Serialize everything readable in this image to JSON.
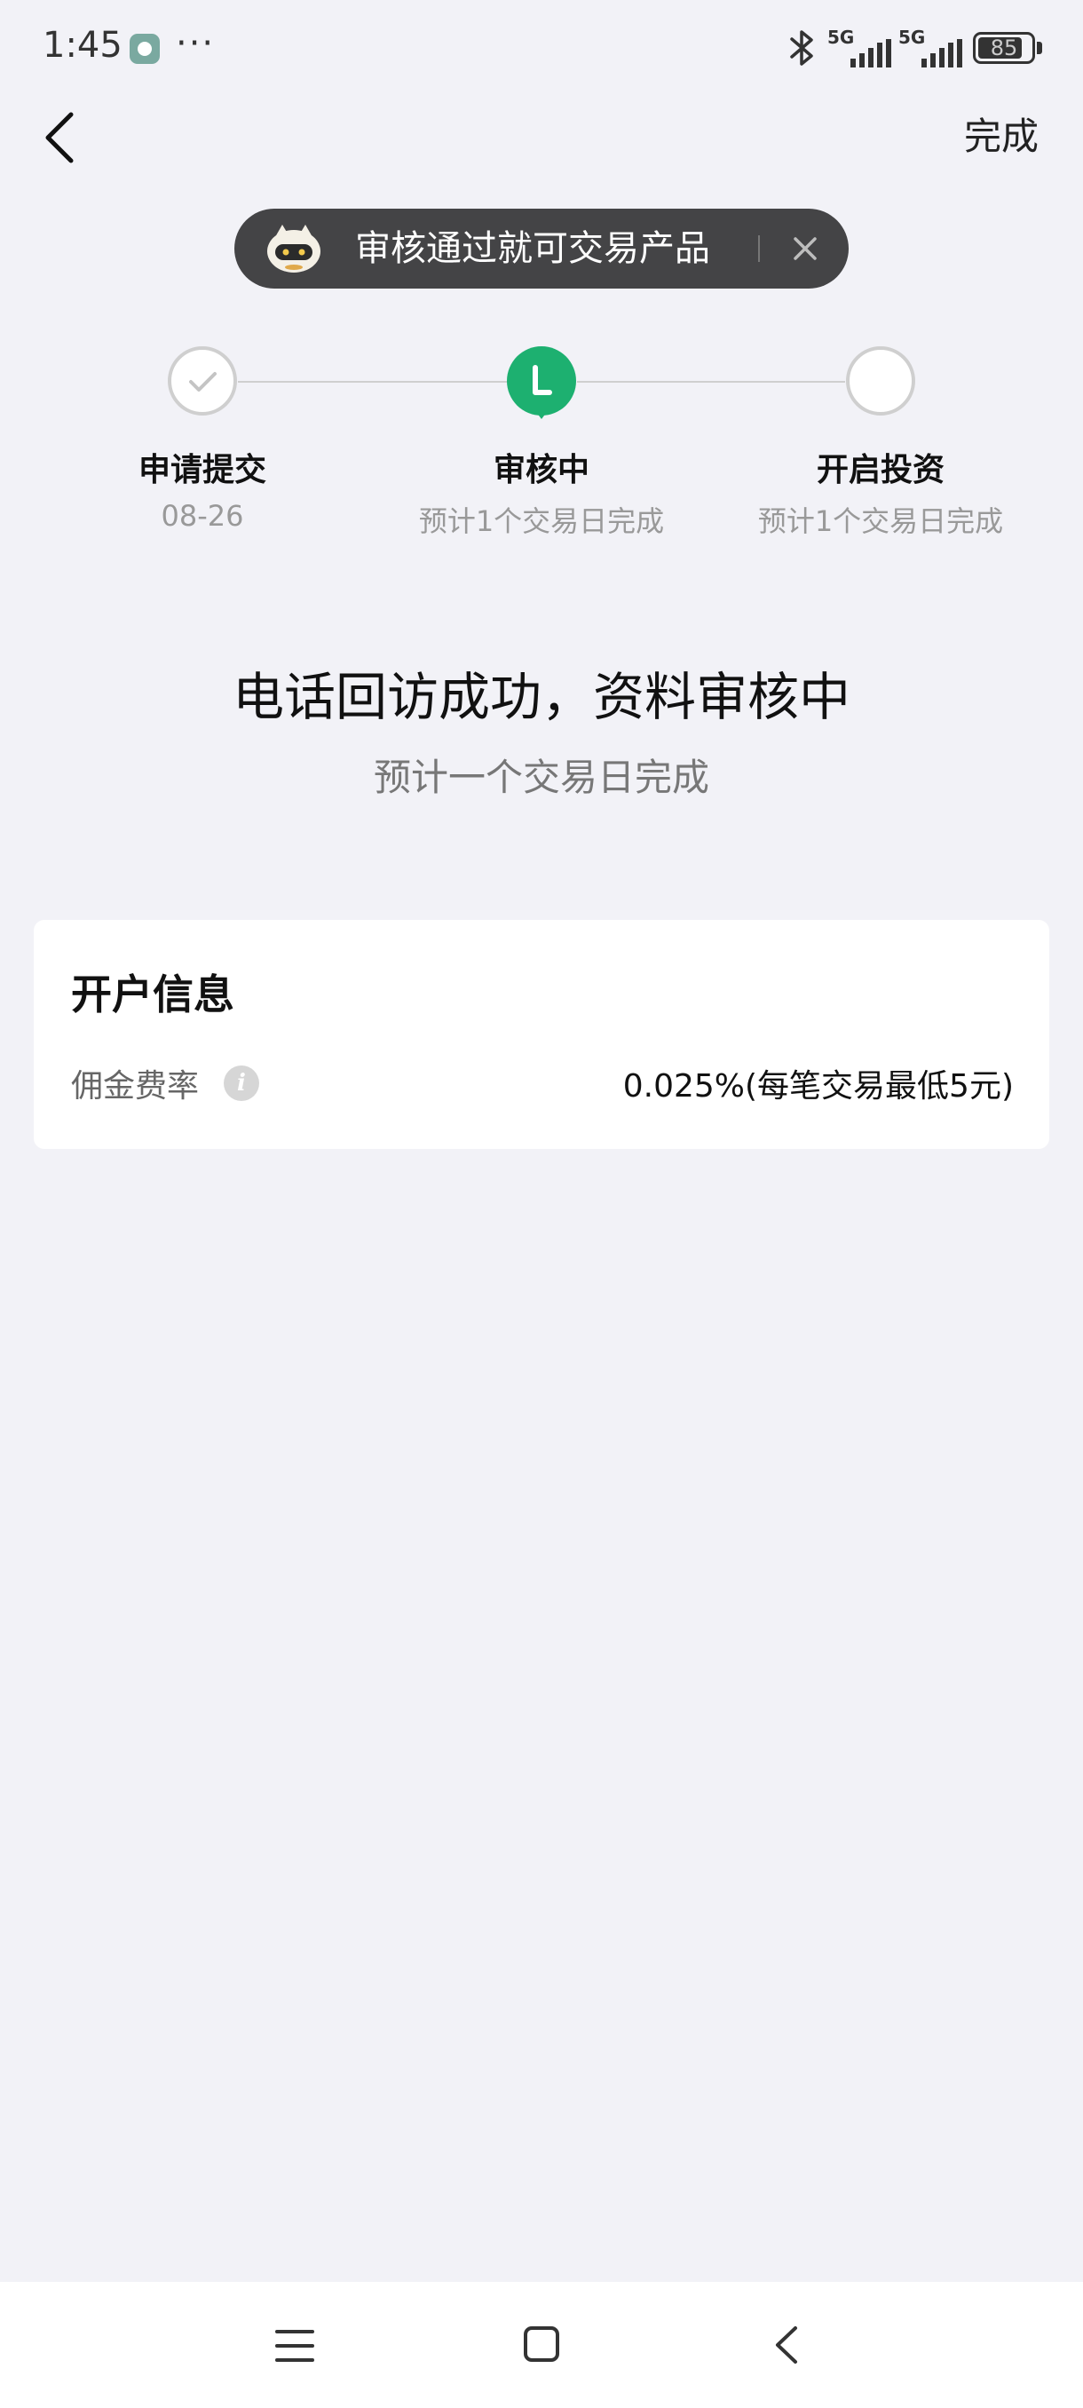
{
  "status_bar": {
    "time": "1:45",
    "dots": "···",
    "network_1": "5G",
    "network_2": "5G",
    "battery": "85",
    "battery_level": 0.85
  },
  "header": {
    "done_label": "完成"
  },
  "toast": {
    "text": "审核通过就可交易产品"
  },
  "steps": [
    {
      "title": "申请提交",
      "subtitle": "08-26",
      "state": "done"
    },
    {
      "title": "审核中",
      "subtitle": "预计1个交易日完成",
      "state": "active"
    },
    {
      "title": "开启投资",
      "subtitle": "预计1个交易日完成",
      "state": "pending"
    }
  ],
  "message": {
    "title": "电话回访成功，资料审核中",
    "subtitle": "预计一个交易日完成"
  },
  "account_info": {
    "title": "开户信息",
    "commission_label": "佣金费率",
    "commission_value": "0.025%(每笔交易最低5元)"
  },
  "colors": {
    "accent": "#1db070",
    "background": "#f2f2f7",
    "toast_bg": "#444446"
  }
}
